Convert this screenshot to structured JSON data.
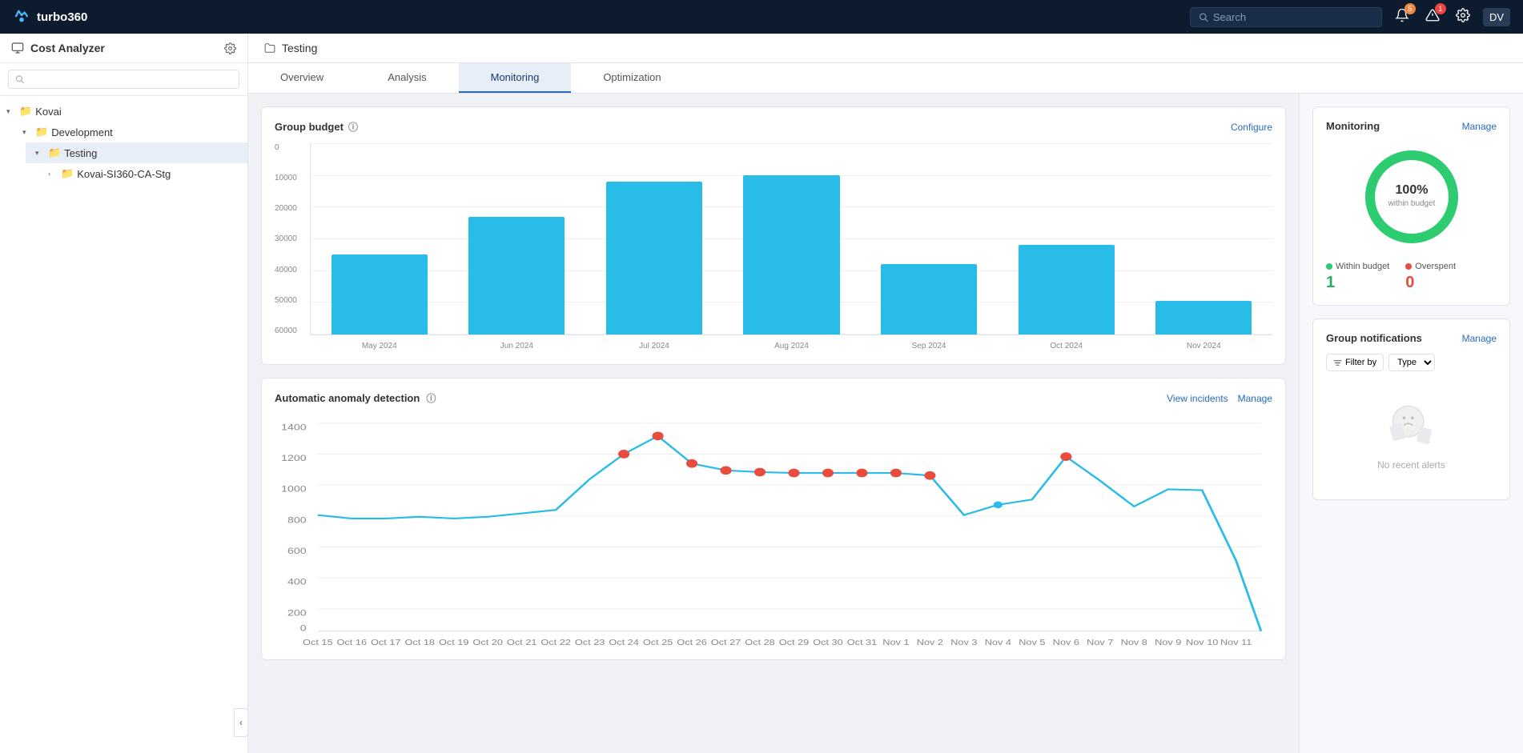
{
  "app": {
    "name": "turbo360"
  },
  "topnav": {
    "search_placeholder": "Search",
    "notifications_count": "5",
    "alerts_count": "1",
    "avatar": "DV"
  },
  "sidebar": {
    "title": "Cost Analyzer",
    "search_placeholder": "",
    "tree": [
      {
        "id": "kovai",
        "label": "Kovai",
        "level": 0,
        "expanded": true
      },
      {
        "id": "development",
        "label": "Development",
        "level": 1,
        "expanded": true
      },
      {
        "id": "testing",
        "label": "Testing",
        "level": 2,
        "expanded": true,
        "active": true
      },
      {
        "id": "kovai-si360",
        "label": "Kovai-SI360-CA-Stg",
        "level": 3,
        "expanded": false
      }
    ],
    "collapse_icon": "‹"
  },
  "page": {
    "title": "Testing",
    "tabs": [
      "Overview",
      "Analysis",
      "Monitoring",
      "Optimization"
    ],
    "active_tab": "Monitoring"
  },
  "group_budget": {
    "title": "Group budget",
    "configure_label": "Configure",
    "y_axis": [
      "0",
      "10000",
      "20000",
      "30000",
      "40000",
      "50000",
      "60000"
    ],
    "bars": [
      {
        "label": "May 2024",
        "value": 25000,
        "max": 60000
      },
      {
        "label": "Jun 2024",
        "value": 37000,
        "max": 60000
      },
      {
        "label": "Jul 2024",
        "value": 48000,
        "max": 60000
      },
      {
        "label": "Aug 2024",
        "value": 50000,
        "max": 60000
      },
      {
        "label": "Sep 2024",
        "value": 22000,
        "max": 60000
      },
      {
        "label": "Oct 2024",
        "value": 28000,
        "max": 60000
      },
      {
        "label": "Nov 2024",
        "value": 10500,
        "max": 60000
      }
    ]
  },
  "anomaly": {
    "title": "Automatic anomaly detection",
    "view_incidents_label": "View incidents",
    "manage_label": "Manage"
  },
  "monitoring": {
    "title": "Monitoring",
    "manage_label": "Manage",
    "donut_percent": "100%",
    "donut_label": "within budget",
    "within_budget_label": "Within budget",
    "within_budget_value": "1",
    "overspent_label": "Overspent",
    "overspent_value": "0"
  },
  "notifications": {
    "title": "Group notifications",
    "manage_label": "Manage",
    "filter_label": "Filter by",
    "type_label": "Type",
    "no_alerts_label": "No recent alerts"
  }
}
